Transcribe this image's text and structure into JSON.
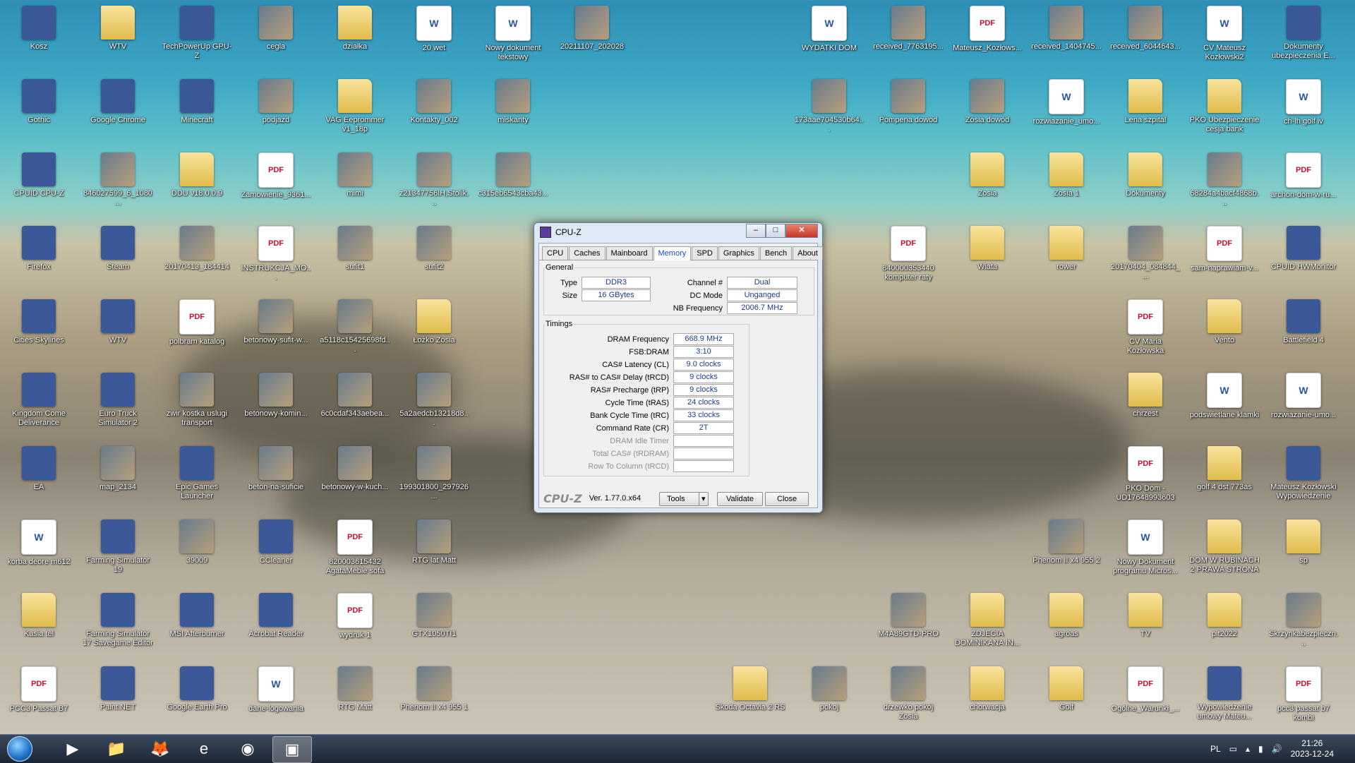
{
  "desktop_icons": [
    {
      "label": "Kosz",
      "type": "app",
      "icon": "recycle-bin-icon"
    },
    {
      "label": "WTV",
      "type": "folder",
      "icon": "folder-icon"
    },
    {
      "label": "TechPowerUp GPU-Z",
      "type": "app",
      "icon": "gpuz-icon"
    },
    {
      "label": "cegla",
      "type": "photo",
      "icon": "image-icon"
    },
    {
      "label": "działka",
      "type": "folder",
      "icon": "folder-icon"
    },
    {
      "label": "20 wet",
      "type": "doc",
      "icon": "document-icon"
    },
    {
      "label": "Nowy dokument tekstowy",
      "type": "doc",
      "icon": "text-file-icon"
    },
    {
      "label": "20211107_202028",
      "type": "photo",
      "icon": "image-icon"
    },
    {
      "label": "WYDATKI DOM",
      "type": "doc",
      "icon": "spreadsheet-icon"
    },
    {
      "label": "received_7763195...",
      "type": "photo",
      "icon": "image-icon"
    },
    {
      "label": "Mateusz_Kozłows...",
      "type": "pdf",
      "icon": "pdf-icon"
    },
    {
      "label": "received_1404745...",
      "type": "photo",
      "icon": "image-icon"
    },
    {
      "label": "received_6044643...",
      "type": "photo",
      "icon": "image-icon"
    },
    {
      "label": "CV Mateusz Kozłowski2",
      "type": "doc",
      "icon": "word-icon"
    },
    {
      "label": "Dokumenty ubezpieczenia E...",
      "type": "app",
      "icon": "archive-icon"
    },
    {
      "label": "Gothic",
      "type": "app",
      "icon": "gothic-icon"
    },
    {
      "label": "Google Chrome",
      "type": "app",
      "icon": "chrome-icon"
    },
    {
      "label": "Minecraft",
      "type": "app",
      "icon": "minecraft-icon"
    },
    {
      "label": "podjazd",
      "type": "photo",
      "icon": "image-icon"
    },
    {
      "label": "VAG Eeprommer v1_18p",
      "type": "folder",
      "icon": "folder-icon"
    },
    {
      "label": "Kontakty_002",
      "type": "photo",
      "icon": "image-icon"
    },
    {
      "label": "miskanty",
      "type": "photo",
      "icon": "image-icon"
    },
    {
      "label": "173aae704530b64...",
      "type": "photo",
      "icon": "image-icon"
    },
    {
      "label": "Pompena dowod",
      "type": "photo",
      "icon": "image-icon"
    },
    {
      "label": "Zosia dowód",
      "type": "photo",
      "icon": "image-icon"
    },
    {
      "label": "rozwiazanie_umo...",
      "type": "doc",
      "icon": "word-icon"
    },
    {
      "label": "Lena szpital",
      "type": "folder",
      "icon": "folder-icon"
    },
    {
      "label": "PKO Ubezpieczenie cesja bank",
      "type": "folder",
      "icon": "folder-icon"
    },
    {
      "label": "ch-lh golf iv",
      "type": "doc",
      "icon": "document-icon"
    },
    {
      "label": "CPUID CPU-Z",
      "type": "app",
      "icon": "cpuz-icon"
    },
    {
      "label": "846027599_6_1080...",
      "type": "photo",
      "icon": "image-icon"
    },
    {
      "label": "DDU v18.0.0.9",
      "type": "folder",
      "icon": "folder-icon"
    },
    {
      "label": "Zamowienie_9361...",
      "type": "pdf",
      "icon": "pdf-icon"
    },
    {
      "label": "mimi",
      "type": "photo",
      "icon": "image-icon"
    },
    {
      "label": "z21347756IH,Stolik...",
      "type": "photo",
      "icon": "image-icon"
    },
    {
      "label": "c315eb6543cba43...",
      "type": "photo",
      "icon": "image-icon"
    },
    {
      "label": "Zosia",
      "type": "folder",
      "icon": "folder-icon"
    },
    {
      "label": "Zosia 1",
      "type": "folder",
      "icon": "folder-icon"
    },
    {
      "label": "Dokumenty",
      "type": "folder",
      "icon": "folder-icon"
    },
    {
      "label": "68284a4bacf4868b...",
      "type": "photo",
      "icon": "image-icon"
    },
    {
      "label": "archon-dom-w-ru...",
      "type": "pdf",
      "icon": "pdf-icon"
    },
    {
      "label": "Firefox",
      "type": "app",
      "icon": "firefox-icon"
    },
    {
      "label": "Steam",
      "type": "app",
      "icon": "steam-icon"
    },
    {
      "label": "20170413_184414",
      "type": "photo",
      "icon": "image-icon"
    },
    {
      "label": "INSTRUKCJA_MO...",
      "type": "pdf",
      "icon": "pdf-icon"
    },
    {
      "label": "sufit1",
      "type": "photo",
      "icon": "image-icon"
    },
    {
      "label": "sufit2",
      "type": "photo",
      "icon": "image-icon"
    },
    {
      "label": "840000353440 komputer raty",
      "type": "pdf",
      "icon": "pdf-icon"
    },
    {
      "label": "Wiata",
      "type": "folder",
      "icon": "folder-icon"
    },
    {
      "label": "rower",
      "type": "folder",
      "icon": "folder-icon"
    },
    {
      "label": "20170404_084844_...",
      "type": "photo",
      "icon": "image-icon"
    },
    {
      "label": "sam-naprawiam-v...",
      "type": "pdf",
      "icon": "pdf-icon"
    },
    {
      "label": "CPUID HWMonitor",
      "type": "app",
      "icon": "hwmonitor-icon"
    },
    {
      "label": "Cities Skylines",
      "type": "app",
      "icon": "cities-skylines-icon"
    },
    {
      "label": "WTV",
      "type": "app",
      "icon": "eye-icon"
    },
    {
      "label": "polbram katalog",
      "type": "pdf",
      "icon": "pdf-icon"
    },
    {
      "label": "betonowy-sufit-w...",
      "type": "photo",
      "icon": "image-icon"
    },
    {
      "label": "a5118c15425698fd...",
      "type": "photo",
      "icon": "image-icon"
    },
    {
      "label": "Łożko Zosia",
      "type": "folder",
      "icon": "folder-icon"
    },
    {
      "label": "CV Maria Kozłowska",
      "type": "pdf",
      "icon": "pdf-icon"
    },
    {
      "label": "Vento",
      "type": "folder",
      "icon": "folder-icon"
    },
    {
      "label": "Battlefield 4",
      "type": "app",
      "icon": "battlefield-icon"
    },
    {
      "label": "Kingdom Come Deliverance",
      "type": "app",
      "icon": "kingdom-come-icon"
    },
    {
      "label": "Euro Truck Simulator 2",
      "type": "app",
      "icon": "truck-icon"
    },
    {
      "label": "zwir kostka uslugi transport",
      "type": "photo",
      "icon": "image-icon"
    },
    {
      "label": "betonowy-komin...",
      "type": "photo",
      "icon": "image-icon"
    },
    {
      "label": "6c0cdaf343aebea...",
      "type": "photo",
      "icon": "image-icon"
    },
    {
      "label": "5a2aedcb13218d8...",
      "type": "photo",
      "icon": "image-icon"
    },
    {
      "label": "chrzest",
      "type": "folder",
      "icon": "folder-icon"
    },
    {
      "label": "podswietlane klamki",
      "type": "doc",
      "icon": "text-file-icon"
    },
    {
      "label": "rozwiazanie-umo...",
      "type": "doc",
      "icon": "word-icon"
    },
    {
      "label": "EA",
      "type": "app",
      "icon": "ea-icon"
    },
    {
      "label": "map_2134",
      "type": "photo",
      "icon": "image-icon"
    },
    {
      "label": "Epic Games Launcher",
      "type": "app",
      "icon": "epic-games-icon"
    },
    {
      "label": "beton-na-suficie",
      "type": "photo",
      "icon": "image-icon"
    },
    {
      "label": "betonowy-w-kuch...",
      "type": "photo",
      "icon": "image-icon"
    },
    {
      "label": "199301800_297926...",
      "type": "photo",
      "icon": "image-icon"
    },
    {
      "label": "PKO Dom - UD17648993603",
      "type": "pdf",
      "icon": "pdf-icon"
    },
    {
      "label": "golf 4 dst 773as",
      "type": "folder",
      "icon": "folder-icon"
    },
    {
      "label": "Mateusz Kozłowski Wypowiedzenie",
      "type": "app",
      "icon": "phone-icon"
    },
    {
      "label": "korba deore m612",
      "type": "doc",
      "icon": "text-file-icon"
    },
    {
      "label": "Farming Simulator 19",
      "type": "app",
      "icon": "fs19-icon"
    },
    {
      "label": "39009",
      "type": "photo",
      "icon": "image-icon"
    },
    {
      "label": "CCleaner",
      "type": "app",
      "icon": "ccleaner-icon"
    },
    {
      "label": "820003615432 AgataMeble sofa",
      "type": "pdf",
      "icon": "pdf-icon"
    },
    {
      "label": "RTG lat Matt",
      "type": "photo",
      "icon": "image-icon"
    },
    {
      "label": "Phenom II x4 955 2",
      "type": "photo",
      "icon": "image-icon"
    },
    {
      "label": "Nowy Dokument programu Micros...",
      "type": "doc",
      "icon": "word-icon"
    },
    {
      "label": "DOM W RUBINACH 2 PRAWA STRONA",
      "type": "folder",
      "icon": "folder-icon"
    },
    {
      "label": "sp",
      "type": "folder",
      "icon": "folder-icon"
    },
    {
      "label": "Kasia tel",
      "type": "folder",
      "icon": "folder-icon"
    },
    {
      "label": "Farming Simulator 17 Savegame Editor",
      "type": "app",
      "icon": "fs17-editor-icon"
    },
    {
      "label": "MSI Afterburner",
      "type": "app",
      "icon": "afterburner-icon"
    },
    {
      "label": "Acrobat Reader",
      "type": "app",
      "icon": "acrobat-icon"
    },
    {
      "label": "wydruk-1",
      "type": "pdf",
      "icon": "pdf-icon"
    },
    {
      "label": "GTX1050TI1",
      "type": "photo",
      "icon": "image-icon"
    },
    {
      "label": "M4A89GTD-PRO",
      "type": "photo",
      "icon": "image-icon"
    },
    {
      "label": "ZDJECIA DOMINIKANA IN...",
      "type": "folder",
      "icon": "folder-icon"
    },
    {
      "label": "agroas",
      "type": "folder",
      "icon": "folder-icon"
    },
    {
      "label": "TV",
      "type": "folder",
      "icon": "folder-icon"
    },
    {
      "label": "pit2022",
      "type": "folder",
      "icon": "folder-icon"
    },
    {
      "label": "Skrzynkabezpieczn...",
      "type": "photo",
      "icon": "image-icon"
    },
    {
      "label": "PCC3 Passat B7",
      "type": "pdf",
      "icon": "pdf-icon"
    },
    {
      "label": "Paint.NET",
      "type": "app",
      "icon": "paintnet-icon"
    },
    {
      "label": "Google Earth Pro",
      "type": "app",
      "icon": "google-earth-icon"
    },
    {
      "label": "dane-logowania",
      "type": "doc",
      "icon": "text-file-icon"
    },
    {
      "label": "RTG Matt",
      "type": "photo",
      "icon": "image-icon"
    },
    {
      "label": "Phenom II x4 955 1",
      "type": "photo",
      "icon": "image-icon"
    },
    {
      "label": "Skoda Octavia 2 RS",
      "type": "folder",
      "icon": "folder-icon"
    },
    {
      "label": "pokoj",
      "type": "photo",
      "icon": "image-icon"
    },
    {
      "label": "drzewko pokój Zosia",
      "type": "photo",
      "icon": "image-icon"
    },
    {
      "label": "chorwacja",
      "type": "folder",
      "icon": "folder-icon"
    },
    {
      "label": "Golf",
      "type": "folder",
      "icon": "folder-icon"
    },
    {
      "label": "Ogólne_Warunki_...",
      "type": "pdf",
      "icon": "pdf-icon"
    },
    {
      "label": "Wypowiedzenie umowy Mateu...",
      "type": "app",
      "icon": "phone-icon"
    },
    {
      "label": "pcc3 passat b7 kombi",
      "type": "pdf",
      "icon": "pdf-icon"
    }
  ],
  "cpuz": {
    "title": "CPU-Z",
    "tabs": [
      "CPU",
      "Caches",
      "Mainboard",
      "Memory",
      "SPD",
      "Graphics",
      "Bench",
      "About"
    ],
    "active_tab": "Memory",
    "general_legend": "General",
    "general": {
      "type_label": "Type",
      "type_value": "DDR3",
      "size_label": "Size",
      "size_value": "16 GBytes",
      "channel_label": "Channel #",
      "channel_value": "Dual",
      "dcmode_label": "DC Mode",
      "dcmode_value": "Unganged",
      "nbfreq_label": "NB Frequency",
      "nbfreq_value": "2006.7 MHz"
    },
    "timings_legend": "Timings",
    "timings": [
      {
        "label": "DRAM Frequency",
        "value": "668.9 MHz",
        "dim": false
      },
      {
        "label": "FSB:DRAM",
        "value": "3:10",
        "dim": false
      },
      {
        "label": "CAS# Latency (CL)",
        "value": "9.0 clocks",
        "dim": false
      },
      {
        "label": "RAS# to CAS# Delay (tRCD)",
        "value": "9 clocks",
        "dim": false
      },
      {
        "label": "RAS# Precharge (tRP)",
        "value": "9 clocks",
        "dim": false
      },
      {
        "label": "Cycle Time (tRAS)",
        "value": "24 clocks",
        "dim": false
      },
      {
        "label": "Bank Cycle Time (tRC)",
        "value": "33 clocks",
        "dim": false
      },
      {
        "label": "Command Rate (CR)",
        "value": "2T",
        "dim": false
      },
      {
        "label": "DRAM Idle Timer",
        "value": "",
        "dim": true
      },
      {
        "label": "Total CAS# (tRDRAM)",
        "value": "",
        "dim": true
      },
      {
        "label": "Row To Column (tRCD)",
        "value": "",
        "dim": true
      }
    ],
    "footer": {
      "brand": "CPU-Z",
      "version": "Ver. 1.77.0.x64",
      "tools_label": "Tools",
      "validate_label": "Validate",
      "close_label": "Close"
    }
  },
  "taskbar": {
    "items": [
      {
        "name": "media-player-icon",
        "glyph": "▶"
      },
      {
        "name": "explorer-icon",
        "glyph": "📁"
      },
      {
        "name": "firefox-icon",
        "glyph": "🦊"
      },
      {
        "name": "internet-explorer-icon",
        "glyph": "e"
      },
      {
        "name": "chrome-icon",
        "glyph": "◉"
      },
      {
        "name": "cpuz-icon",
        "glyph": "▣",
        "active": true
      }
    ],
    "language": "PL",
    "time": "21:26",
    "date": "2023-12-24"
  }
}
